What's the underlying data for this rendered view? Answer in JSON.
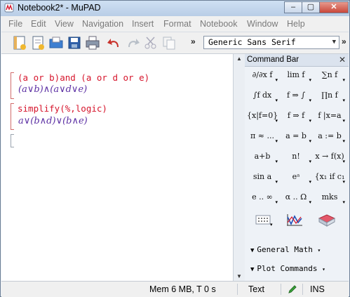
{
  "window": {
    "title": "Notebook2* - MuPAD"
  },
  "window_controls": {
    "minimize": "–",
    "maximize": "▢",
    "close": "✕"
  },
  "menu": [
    "File",
    "Edit",
    "View",
    "Navigation",
    "Insert",
    "Format",
    "Notebook",
    "Window",
    "Help"
  ],
  "toolbar": {
    "buttons": [
      "new-notebook",
      "new-editor",
      "open",
      "save",
      "print",
      "undo",
      "redo",
      "cut",
      "copy"
    ],
    "overflow": "»",
    "overflow2": "»",
    "font": "Generic Sans Serif"
  },
  "notebook": {
    "input1": "(a or b)and (a or d or e)",
    "output1": "(a∨b)∧(a∨d∨e)",
    "input2": "simplify(%,logic)",
    "output2": "a∨(b∧d)∨(b∧e)"
  },
  "command_bar": {
    "title": "Command Bar",
    "close": "✕",
    "buttons": [
      "∂/∂x f",
      "lim f",
      "∑n f",
      "∫f dx",
      "f ⇒ ∫",
      "∏n f",
      "{x|f=0}",
      "f ⇒ f",
      "f |x=a",
      "π ≈ ...",
      "a = b",
      "a := b",
      "a+b",
      "n!",
      "x → f(x)",
      "sin a",
      "eᵃ",
      "{x₁ if c₁",
      "e .. ∞",
      "α .. Ω",
      "mks"
    ],
    "general_math": "General Math",
    "plot_commands": "Plot Commands"
  },
  "status": {
    "memory": "Mem 6 MB, T 0 s",
    "mode": "Text",
    "insert": "INS"
  },
  "colors": {
    "input": "#d6142b",
    "output": "#5b2fa3"
  }
}
